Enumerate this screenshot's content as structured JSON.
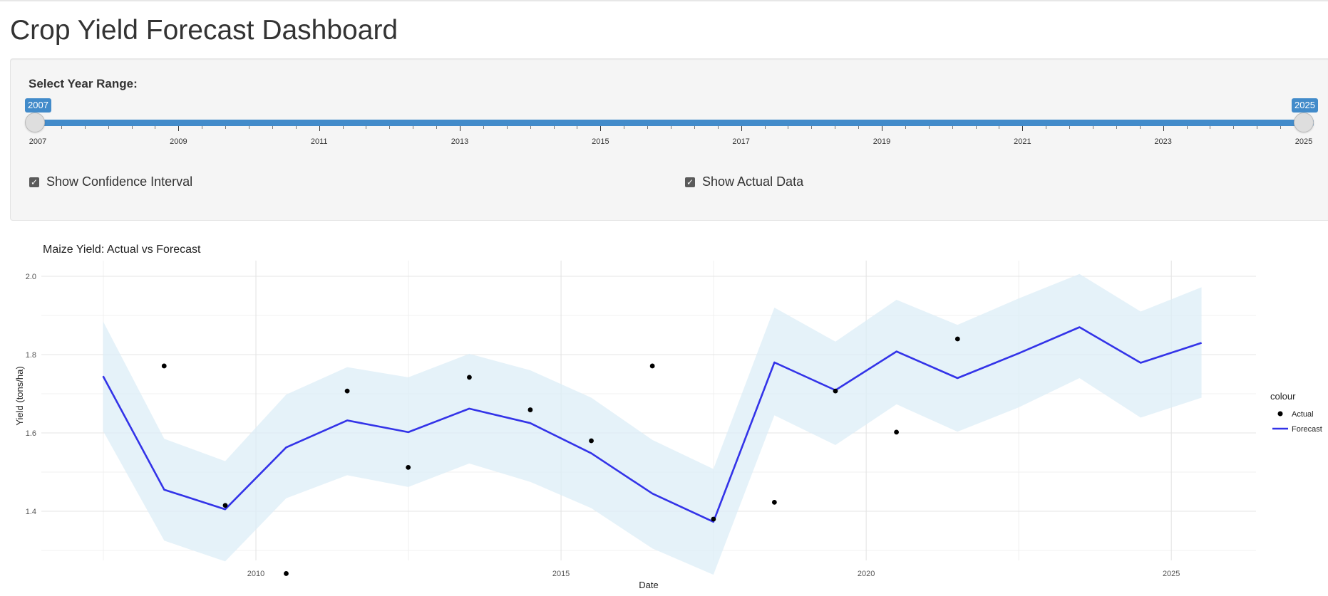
{
  "page": {
    "title": "Crop Yield Forecast Dashboard"
  },
  "controls": {
    "slider": {
      "label": "Select Year Range:",
      "min": 2007,
      "max": 2025,
      "from": "2007",
      "to": "2025",
      "tick_labels": [
        "2007",
        "2009",
        "2011",
        "2013",
        "2015",
        "2017",
        "2019",
        "2021",
        "2023",
        "2025"
      ]
    },
    "show_ci": {
      "label": "Show Confidence Interval",
      "checked": true
    },
    "show_actual": {
      "label": "Show Actual Data",
      "checked": true
    }
  },
  "colors": {
    "accent": "#428bca",
    "forecast": "#3333e8",
    "ci_band": "#dcedf7",
    "actual": "#000000"
  },
  "chart_data": {
    "type": "line",
    "title": "Maize Yield: Actual vs Forecast",
    "xlabel": "Date",
    "ylabel": "Yield (tons/ha)",
    "x_ticks": [
      "2010",
      "2015",
      "2020",
      "2025"
    ],
    "y_ticks": [
      "1.4",
      "1.6",
      "1.8",
      "2.0"
    ],
    "ylim": [
      1.22,
      2.04
    ],
    "grid": true,
    "legend": {
      "title": "colour",
      "position": "right",
      "entries": [
        "Actual",
        "Forecast"
      ]
    },
    "x": [
      "2007-07-01",
      "2008-07-01",
      "2009-07-01",
      "2010-07-01",
      "2011-07-01",
      "2012-07-01",
      "2013-07-01",
      "2014-07-01",
      "2015-07-01",
      "2016-07-01",
      "2017-07-01",
      "2018-07-01",
      "2019-07-01",
      "2020-07-01",
      "2021-07-01",
      "2022-07-01",
      "2023-07-01",
      "2024-07-01",
      "2025-07-01"
    ],
    "series": [
      {
        "name": "Forecast",
        "values": [
          1.745,
          1.455,
          1.405,
          1.563,
          1.632,
          1.602,
          1.662,
          1.625,
          1.548,
          1.445,
          1.373,
          1.78,
          1.709,
          1.808,
          1.74,
          1.803,
          1.87,
          1.779,
          1.83
        ]
      },
      {
        "name": "Actual",
        "values": [
          1.771,
          1.415,
          1.241,
          1.707,
          1.512,
          1.742,
          1.659,
          1.58,
          1.771,
          1.38,
          1.423,
          1.707,
          1.602,
          1.84,
          null,
          null,
          null,
          null,
          null
        ]
      }
    ],
    "ci_lower": [
      1.605,
      1.325,
      1.272,
      1.433,
      1.492,
      1.462,
      1.522,
      1.475,
      1.408,
      1.305,
      1.238,
      1.645,
      1.569,
      1.673,
      1.603,
      1.665,
      1.74,
      1.639,
      1.69
    ],
    "ci_upper": [
      1.885,
      1.585,
      1.528,
      1.698,
      1.768,
      1.742,
      1.802,
      1.76,
      1.69,
      1.582,
      1.508,
      1.92,
      1.833,
      1.94,
      1.876,
      1.943,
      2.006,
      1.91,
      1.972
    ]
  }
}
